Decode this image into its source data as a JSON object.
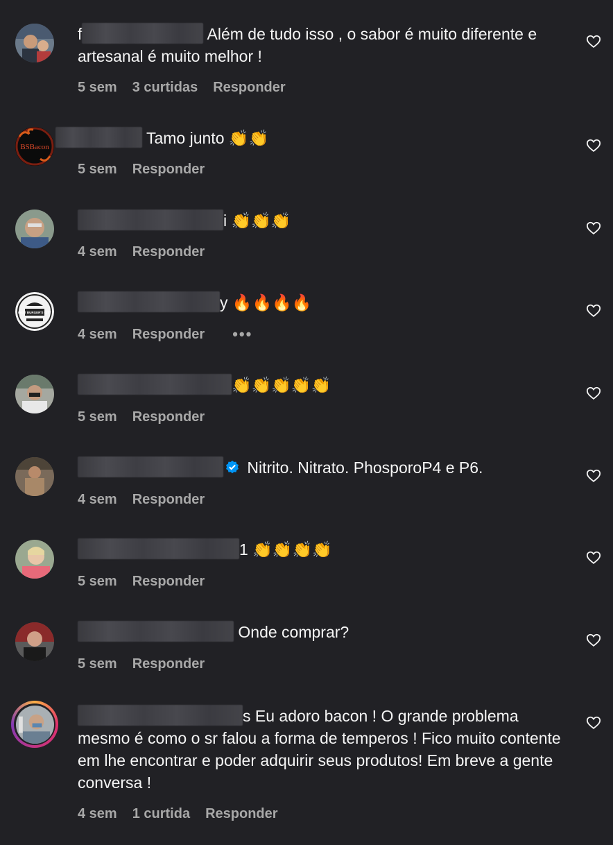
{
  "comments": [
    {
      "prefix": "f",
      "text": " Além de tudo isso , o sabor é muito diferente e artesanal é muito melhor !",
      "time": "5 sem",
      "likes": "3 curtidas",
      "reply": "Responder"
    },
    {
      "prefix": "",
      "text": " Tamo junto 👏👏",
      "time": "5 sem",
      "reply": "Responder"
    },
    {
      "prefix": "",
      "text": "i 👏👏👏",
      "time": "4 sem",
      "reply": "Responder"
    },
    {
      "prefix": "",
      "text": "y 🔥🔥🔥🔥",
      "time": "4 sem",
      "reply": "Responder",
      "more": "•••"
    },
    {
      "prefix": "",
      "text": "👏👏👏👏👏",
      "time": "5 sem",
      "reply": "Responder"
    },
    {
      "prefix": "",
      "text": " Nitrito. Nitrato. PhosporoP4 e P6.",
      "time": "4 sem",
      "reply": "Responder"
    },
    {
      "prefix": "",
      "text": "1 👏👏👏👏",
      "time": "5 sem",
      "reply": "Responder"
    },
    {
      "prefix": "",
      "text": " Onde comprar?",
      "time": "5 sem",
      "reply": "Responder"
    },
    {
      "prefix": "",
      "text": "s Eu adoro bacon ! O grande problema mesmo é como o sr falou a forma de temperos ! Fico muito contente em lhe encontrar e poder adquirir seus produtos! Em breve a gente conversa !",
      "time": "4 sem",
      "likes": "1 curtida",
      "reply": "Responder"
    }
  ],
  "avatars": {
    "bsbacon_logo_text": "BSBacon",
    "burger_logo_text": "FAST BURGER'S CITY"
  },
  "colors": {
    "background": "#212125",
    "text": "#f5f5f5",
    "meta": "#a8a8a8",
    "verified": "#0095f6"
  }
}
